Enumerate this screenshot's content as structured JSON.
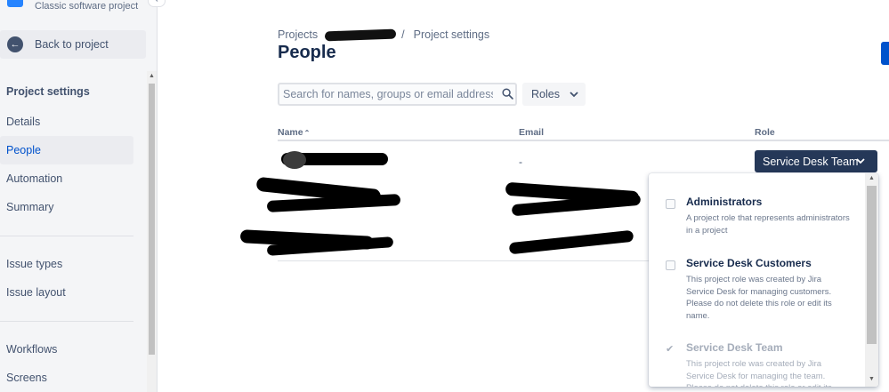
{
  "sidebar": {
    "project_type": "Classic software project",
    "back_label": "Back to project",
    "heading": "Project settings",
    "items": [
      {
        "label": "Details"
      },
      {
        "label": "People"
      },
      {
        "label": "Automation"
      },
      {
        "label": "Summary"
      },
      {
        "label": "Issue types"
      },
      {
        "label": "Issue layout"
      },
      {
        "label": "Workflows"
      },
      {
        "label": "Screens"
      }
    ],
    "active_item": "People"
  },
  "breadcrumb": {
    "root": "Projects",
    "separator": "/",
    "current": "Project settings"
  },
  "page": {
    "title": "People"
  },
  "search": {
    "placeholder": "Search for names, groups or email addresses",
    "value": ""
  },
  "roles_filter": {
    "label": "Roles"
  },
  "table": {
    "columns": {
      "name": "Name",
      "sort_indicator": "⌃",
      "email": "Email",
      "role": "Role"
    },
    "rows": [
      {
        "email": "-",
        "role": "Service Desk Team"
      }
    ]
  },
  "role_dropdown": {
    "options": [
      {
        "title": "Administrators",
        "description": "A project role that represents administrators in a project",
        "checked": false
      },
      {
        "title": "Service Desk Customers",
        "description": "This project role was created by Jira Service Desk for managing customers. Please do not delete this role or edit its name.",
        "checked": false
      },
      {
        "title": "Service Desk Team",
        "description": "This project role was created by Jira Service Desk for managing the team. Please do not delete this role or edit its name.",
        "checked": true
      }
    ]
  },
  "colors": {
    "accent": "#0052cc",
    "role_button": "#253858",
    "sidebar_bg": "#f4f5f7"
  }
}
